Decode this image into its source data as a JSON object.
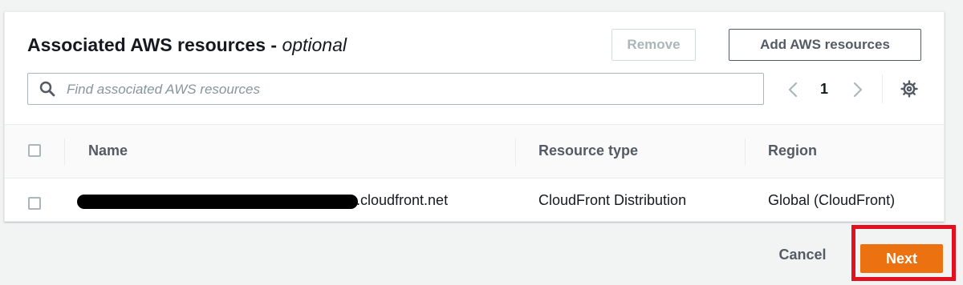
{
  "section": {
    "title": "Associated AWS resources - ",
    "title_optional": "optional",
    "remove_label": "Remove",
    "add_label": "Add AWS resources"
  },
  "search": {
    "placeholder": "Find associated AWS resources",
    "icon": "search-icon"
  },
  "pagination": {
    "current_page": "1"
  },
  "table": {
    "columns": [
      "Name",
      "Resource type",
      "Region"
    ],
    "rows": [
      {
        "name_suffix": ".cloudfront.net",
        "resource_type": "CloudFront Distribution",
        "region": "Global (CloudFront)"
      }
    ]
  },
  "footer": {
    "cancel_label": "Cancel",
    "next_label": "Next"
  },
  "colors": {
    "primary": "#ec7211",
    "highlight": "#e3101f",
    "border": "#aab7b8",
    "text": "#16191f",
    "muted": "#545b64"
  }
}
